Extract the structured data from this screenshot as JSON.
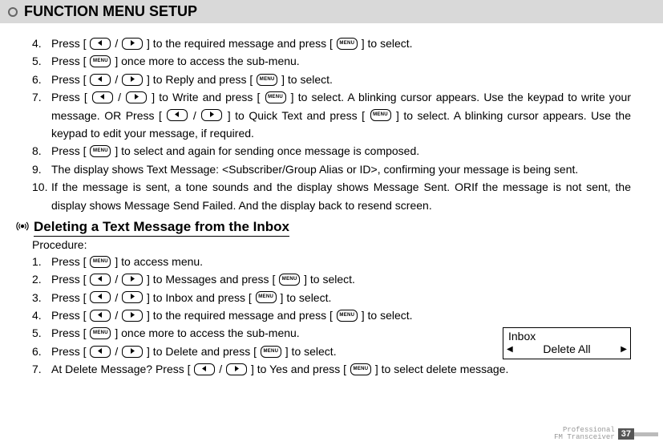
{
  "header": "FUNCTION MENU SETUP",
  "keys": {
    "menu": "MENU"
  },
  "stepsA": [
    {
      "n": "4.",
      "pre": "Press [ ",
      "mid1": " / ",
      "mid2": " ] to the required message and press [ ",
      "post": " ] to select."
    },
    {
      "n": "5.",
      "pre": "Press [ ",
      "post": " ] once more to access the sub-menu."
    },
    {
      "n": "6.",
      "pre": "Press [ ",
      "mid1": " / ",
      "mid2": " ] to Reply and press [ ",
      "post": " ] to select."
    },
    {
      "n": "7.",
      "pre": "Press [ ",
      "mid1": " / ",
      "mid2": " ] to Write and press [ ",
      "mid3": " ] to select. A blinking cursor appears. Use the keypad to write your message. OR Press [ ",
      "mid4": " / ",
      "mid5": " ] to Quick Text and press [ ",
      "post": " ] to select. A blinking cursor appears. Use the keypad to edit your message, if required."
    },
    {
      "n": "8.",
      "pre": "Press [ ",
      "post": " ] to select and again for sending once message is composed."
    },
    {
      "n": "9.",
      "text": "The display shows Text Message: <Subscriber/Group Alias or ID>, confirming your message is being sent."
    },
    {
      "n": "10.",
      "text": "If the message is sent, a tone sounds and the display shows Message Sent. ORIf the message is not sent, the display shows Message Send Failed. And the display back to resend screen."
    }
  ],
  "subheader": "Deleting a Text Message from the Inbox",
  "procedure": "Procedure:",
  "stepsB": [
    {
      "n": "1.",
      "pre": "Press [ ",
      "post": " ] to access menu."
    },
    {
      "n": "2.",
      "pre": "Press [ ",
      "mid1": " / ",
      "mid2": " ] to Messages and press  [ ",
      "post": " ]  to select."
    },
    {
      "n": "3.",
      "pre": "Press [ ",
      "mid1": " / ",
      "mid2": " ] to Inbox and press [ ",
      "post": " ] to select."
    },
    {
      "n": "4.",
      "pre": "Press [ ",
      "mid1": " / ",
      "mid2": " ] to the required message and press [ ",
      "post": " ] to select."
    },
    {
      "n": "5.",
      "pre": "Press [ ",
      "post": " ] once more to access the sub-menu."
    },
    {
      "n": "6.",
      "pre": "Press [ ",
      "mid1": " / ",
      "mid2": " ] to Delete and press  [ ",
      "post": " ] to select."
    },
    {
      "n": "7.",
      "pre": "At Delete Message? Press [ ",
      "mid1": " / ",
      "mid2": " ] to Yes and press [ ",
      "post": " ] to select delete message."
    }
  ],
  "screen": {
    "line1": "Inbox",
    "line2": "Delete All"
  },
  "footer": {
    "line1": "Professional",
    "line2": "FM Transceiver",
    "page": "37"
  }
}
